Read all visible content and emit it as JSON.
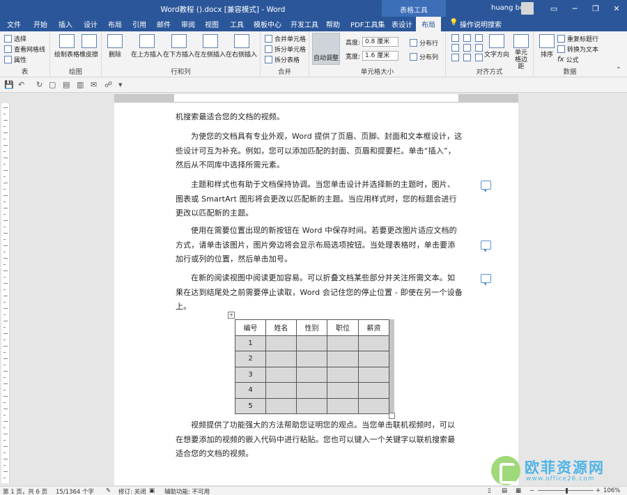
{
  "window": {
    "title": "Word教程 ().docx [兼容模式] - Word",
    "context_group": "表格工具",
    "user": "huang bo",
    "controls": [
      "▭",
      "─",
      "❐",
      "✕"
    ]
  },
  "tabs": [
    "文件",
    "开始",
    "插入",
    "设计",
    "布局",
    "引用",
    "邮件",
    "审阅",
    "视图",
    "工具",
    "模板中心",
    "开发工具",
    "帮助",
    "PDF工具集",
    "表设计",
    "布局",
    "操作说明搜索"
  ],
  "ribbon": {
    "table": {
      "select": "选择",
      "gridlines": "查看网格线",
      "properties": "属性",
      "label": "表"
    },
    "draw": {
      "draw_table": "绘制表格",
      "eraser": "橡皮擦",
      "label": "绘图"
    },
    "rows_cols": {
      "delete": "删除",
      "insert_above": "在上方插入",
      "insert_below": "在下方插入",
      "insert_left": "在左侧插入",
      "insert_right": "在右侧插入",
      "label": "行和列"
    },
    "merge": {
      "merge_cells": "合并单元格",
      "split_cells": "拆分单元格",
      "split_table": "拆分表格",
      "label": "合并"
    },
    "cell_size": {
      "autofit": "自动调整",
      "height_label": "高度:",
      "height_value": "0.8 厘米",
      "width_label": "宽度:",
      "width_value": "1.6 厘米",
      "distribute_rows": "分布行",
      "distribute_cols": "分布列",
      "label": "单元格大小"
    },
    "alignment": {
      "text_direction": "文字方向",
      "cell_margins": "单元格边距",
      "label": "对齐方式"
    },
    "data": {
      "sort": "排序",
      "repeat_header": "重复标题行",
      "convert_text": "转换为文本",
      "formula": "公式",
      "label": "数据"
    }
  },
  "document": {
    "paragraphs": [
      "机搜索最适合您的文档的视频。",
      "为使您的文档具有专业外观，Word 提供了页眉、页脚、封面和文本框设计，这些设计可互为补充。例如，您可以添加匹配的封面、页眉和提要栏。单击“插入”，然后从不同库中选择所需元素。",
      "主题和样式也有助于文档保持协调。当您单击设计并选择新的主题时，图片、图表或 SmartArt 图形将会更改以匹配新的主题。当应用样式时，您的标题会进行更改以匹配新的主题。",
      "使用在需要位置出现的新按钮在 Word 中保存时间。若要更改图片适应文档的方式，请单击该图片，图片旁边将会显示布局选项按钮。当处理表格时，单击要添加行或列的位置，然后单击加号。",
      "在新的阅读视图中阅读更加容易。可以折叠文档某些部分并关注所需文本。如果在达到结尾处之前需要停止读取，Word 会记住您的停止位置 - 即使在另一个设备上。",
      "视频提供了功能强大的方法帮助您证明您的观点。当您单击联机视频时，可以在想要添加的视频的嵌入代码中进行粘贴。您也可以键入一个关键字以联机搜索最适合您的文档的视频。"
    ],
    "table": {
      "headers": [
        "编号",
        "姓名",
        "性别",
        "职位",
        "薪资"
      ],
      "rows": [
        "1",
        "2",
        "3",
        "4",
        "5"
      ]
    }
  },
  "statusbar": {
    "page": "第 1 页，共 6 页",
    "words": "15/1364 个字",
    "track": "修订: 关闭",
    "accessibility": "辅助功能: 不可用",
    "zoom": "106%"
  },
  "watermark": {
    "title": "欧菲资源网",
    "url": "www.office26.com"
  }
}
